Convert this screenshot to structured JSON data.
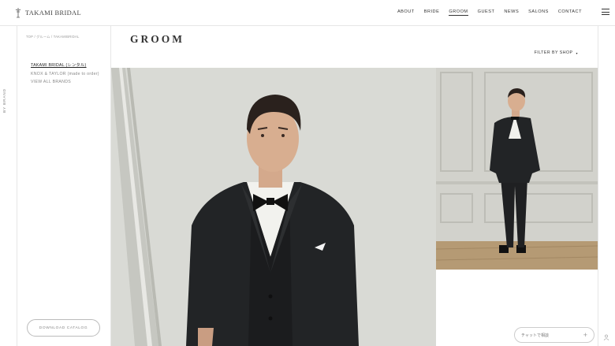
{
  "header": {
    "brand": "TAKAMI BRIDAL",
    "nav": [
      "ABOUT",
      "BRIDE",
      "GROOM",
      "GUEST",
      "NEWS",
      "SALONS",
      "CONTACT"
    ],
    "active_nav": "GROOM"
  },
  "rail": {
    "label": "BY BRAND"
  },
  "sidebar": {
    "breadcrumb": [
      "TOP",
      "グルーム",
      "TAKAMIBRIDAL"
    ],
    "brands": [
      {
        "label": "TAKAMI BRIDAL (レンタル)",
        "active": true
      },
      {
        "label": "KNOX & TAYLOR (made to order)",
        "active": false
      },
      {
        "label": "VIEW ALL BRANDS",
        "active": false
      }
    ],
    "download_label": "DOWNLOAD CATALOG"
  },
  "main": {
    "title": "GROOM",
    "filter_label": "FILTER BY SHOP"
  },
  "chat": {
    "label": "チャットで相談"
  },
  "colors": {
    "suit": "#222426",
    "wall": "#d7d8d3",
    "floor": "#b59a74"
  }
}
